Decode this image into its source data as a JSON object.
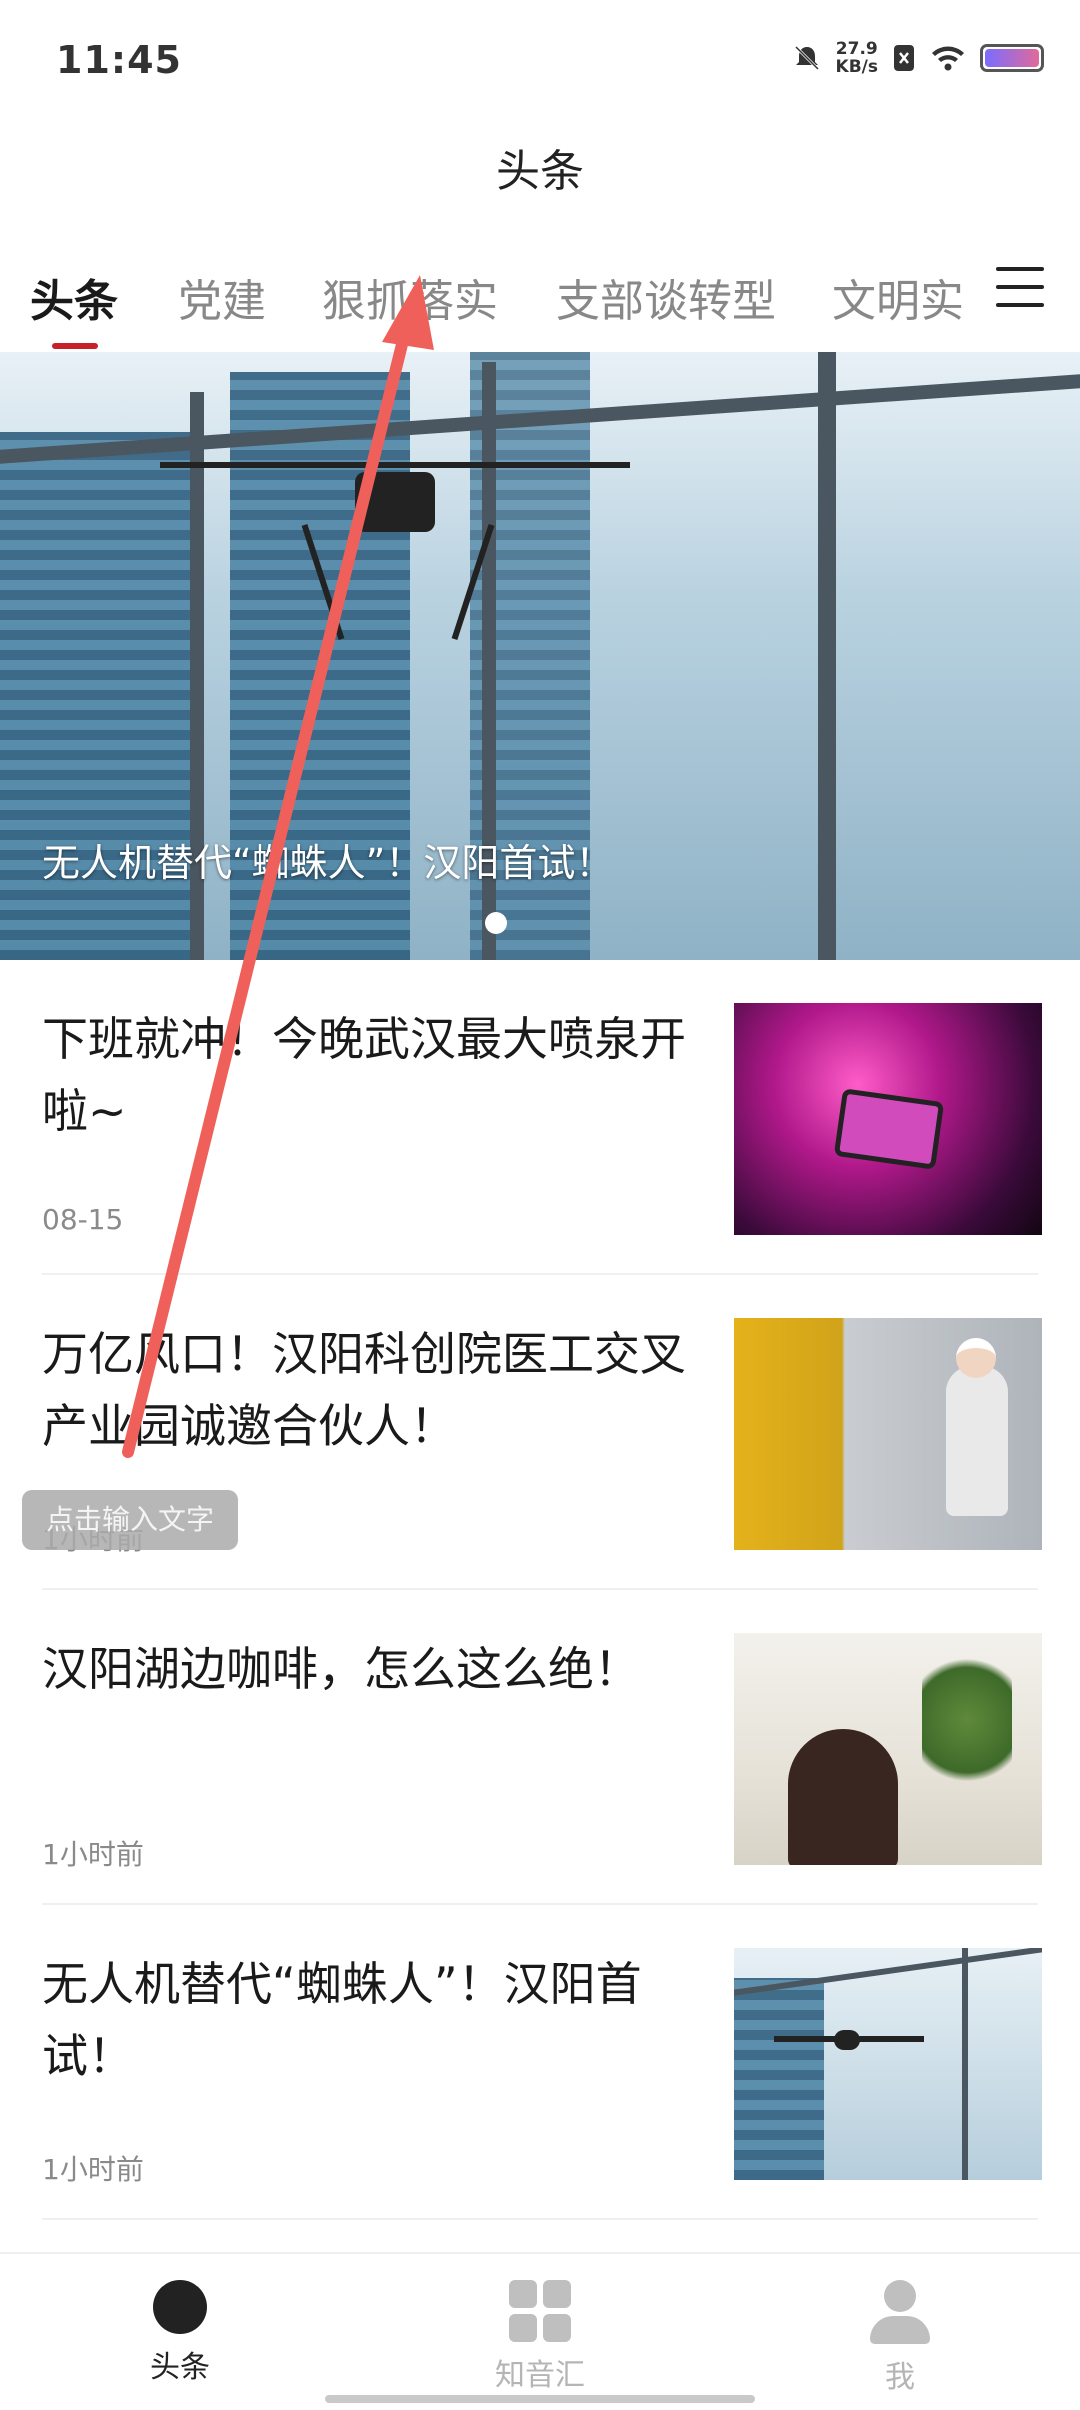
{
  "status_bar": {
    "time": "11:45",
    "net_speed_value": "27.9",
    "net_speed_unit": "KB/s"
  },
  "header": {
    "title": "头条"
  },
  "tabs": [
    {
      "label": "头条",
      "active": true
    },
    {
      "label": "党建"
    },
    {
      "label": "狠抓落实"
    },
    {
      "label": "支部谈转型"
    },
    {
      "label": "文明实"
    }
  ],
  "banner": {
    "caption": "无人机替代“蜘蛛人”！汉阳首试！"
  },
  "news": [
    {
      "title": "下班就冲！今晚武汉最大喷泉开啦~",
      "meta": "08-15"
    },
    {
      "title": "万亿风口！汉阳科创院医工交叉产业园诚邀合伙人！",
      "meta": "1小时前"
    },
    {
      "title": "汉阳湖边咖啡，怎么这么绝！",
      "meta": "1小时前"
    },
    {
      "title": "无人机替代“蜘蛛人”！汉阳首试！",
      "meta": "1小时前"
    }
  ],
  "overlay": {
    "input_tag": "点击输入文字",
    "arrow_color": "#f0605a"
  },
  "bottom_nav": [
    {
      "label": "头条",
      "active": true
    },
    {
      "label": "知音汇"
    },
    {
      "label": "我"
    }
  ],
  "colors": {
    "accent": "#c8202a",
    "inactive": "#888888"
  }
}
